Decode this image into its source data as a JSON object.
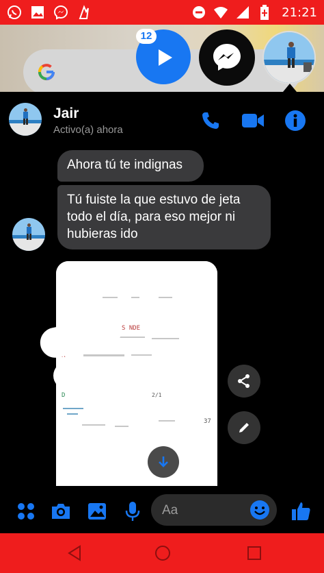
{
  "status_bar": {
    "time": "21:21",
    "left_icons": [
      "whatsapp-icon",
      "gallery-icon",
      "messenger-icon",
      "app-icon"
    ],
    "right_icons": [
      "do-not-disturb-icon",
      "wifi-icon",
      "signal-icon",
      "battery-icon"
    ]
  },
  "chat_heads": {
    "badge_count": "12"
  },
  "conversation": {
    "contact_name": "Jair",
    "contact_status": "Activo(a) ahora",
    "messages": [
      {
        "text": "Ahora tú te indignas"
      },
      {
        "text": "Tú fuiste la que estuvo de jeta todo el día, para eso mejor ni hubieras ido"
      }
    ],
    "photo_label_fragments": [
      "-",
      "S     NDE",
      "5",
      "R",
      "D",
      "2/1",
      "37"
    ]
  },
  "composer": {
    "placeholder": "Aa"
  },
  "colors": {
    "accent": "#1877f2",
    "status_bar": "#ef1d1d",
    "bubble": "#3a3a3c",
    "background": "#000000"
  }
}
